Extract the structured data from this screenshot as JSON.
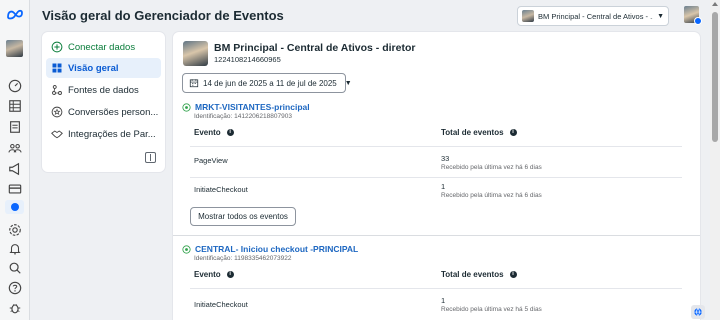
{
  "header": {
    "title": "Visão geral do Gerenciador de Eventos",
    "business_selector": "BM Principal - Central de Ativos - ..."
  },
  "rail": {
    "icons": [
      "meta-logo-icon",
      "account-avatar",
      "dashboard-icon",
      "table-icon",
      "pages-icon",
      "people-icon",
      "megaphone-icon",
      "card-icon",
      "events-manager-icon",
      "settings-icon",
      "bell-icon",
      "search-icon",
      "help-icon",
      "bug-icon"
    ]
  },
  "sidebar": {
    "items": [
      {
        "label": "Conectar dados",
        "icon": "plus-circle-icon"
      },
      {
        "label": "Visão geral",
        "icon": "grid-icon",
        "active": true
      },
      {
        "label": "Fontes de dados",
        "icon": "data-sources-icon"
      },
      {
        "label": "Conversões person...",
        "icon": "star-icon"
      },
      {
        "label": "Integrações de Par...",
        "icon": "handshake-icon"
      }
    ]
  },
  "main": {
    "asset_name": "BM Principal - Central de Ativos - diretor",
    "asset_id": "1224108214660965",
    "date_range": "14 de jun de 2025 a 11 de jul de 2025",
    "col_event": "Evento",
    "col_total": "Total de eventos",
    "datasets": [
      {
        "name": "MRKT-VISITANTES-principal",
        "id_text": "Identificação: 1412206218807903",
        "rows": [
          {
            "event": "PageView",
            "count": "33",
            "received": "Recebido pela última vez há 6 dias"
          },
          {
            "event": "InitiateCheckout",
            "count": "1",
            "received": "Recebido pela última vez há 6 dias"
          }
        ],
        "show_all": "Mostrar todos os eventos"
      },
      {
        "name": "CENTRAL- Iniciou checkout -PRINCIPAL",
        "id_text": "Identificação: 1198335462073922",
        "rows": [
          {
            "event": "InitiateCheckout",
            "count": "1",
            "received": "Recebido pela última vez há 5 dias"
          }
        ]
      }
    ]
  },
  "colors": {
    "accent": "#0866ff",
    "link": "#1d67c1",
    "active_bg": "#e7f0fb",
    "connect_green": "#0a7d3b",
    "background": "#eef0f3"
  }
}
